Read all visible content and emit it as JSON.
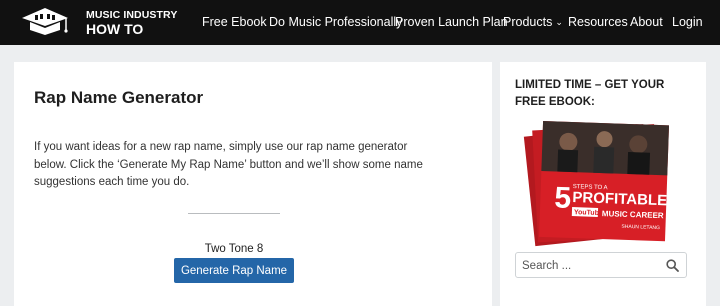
{
  "header": {
    "brand_line1": "MUSIC INDUSTRY",
    "brand_line2": "HOW TO",
    "nav": [
      {
        "label": "Free Ebook"
      },
      {
        "label": "Do Music Professionally"
      },
      {
        "label": "Proven Launch Plan"
      },
      {
        "label": "Products",
        "has_dropdown": true
      },
      {
        "label": "Resources"
      },
      {
        "label": "About"
      },
      {
        "label": "Login"
      }
    ]
  },
  "main": {
    "title": "Rap Name Generator",
    "intro": "If you want ideas for a new rap name, simply use our rap name generator below. Click the ‘Generate My Rap Name’ button and we’ll show some name suggestions each time you do.",
    "result": "Two Tone 8",
    "button_label": "Generate Rap Name"
  },
  "sidebar": {
    "promo_title": "LIMITED TIME – GET YOUR FREE EBOOK:",
    "ebook": {
      "cover_number": "5",
      "cover_small": "STEPS TO A",
      "cover_word": "PROFITABLE",
      "cover_sub": "MUSIC CAREER",
      "cover_brand": "YouTube",
      "cover_author": "SHAUN LETANG"
    },
    "search_placeholder": "Search ..."
  },
  "colors": {
    "header_bg": "#111111",
    "page_bg": "#eceef0",
    "button": "#2466a8",
    "ebook_red": "#d71f26"
  },
  "icons": {
    "logo": "piano-graduation-cap-icon",
    "search": "search-icon",
    "dropdown": "chevron-down-icon"
  }
}
